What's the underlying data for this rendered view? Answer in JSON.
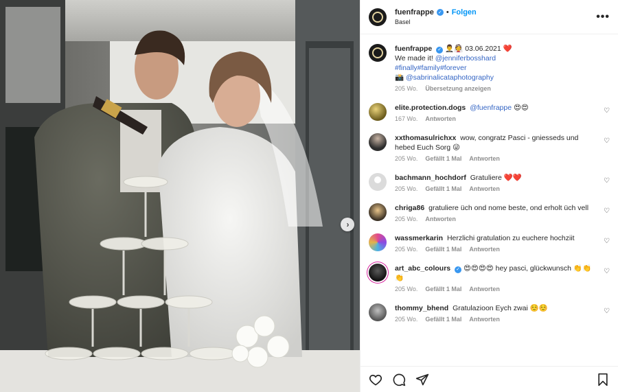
{
  "post": {
    "username": "fuenfrappe",
    "follow_label": "Folgen",
    "dot": "•",
    "location": "Basel",
    "more_label": "•••",
    "next_label": "›"
  },
  "caption": {
    "username": "fuenfrappe",
    "emoji_prefix": "🤵‍♂️👰",
    "date": "03.06.2021",
    "heart": "❤️",
    "line1_text": "We made it!",
    "line1_mention": "@jenniferbosshard",
    "line2_tags": "#finally#family#forever",
    "line3_emoji": "📸",
    "line3_mention": "@sabrinalicataphotography",
    "age": "205 Wo.",
    "translate": "Übersetzung anzeigen"
  },
  "comments": [
    {
      "username": "elite.protection.dogs",
      "text": "",
      "mention": "@fuenfrappe",
      "suffix": "😍😍",
      "age": "167 Wo.",
      "likes": "",
      "reply": "Antworten"
    },
    {
      "username": "xxthomasulrichxx",
      "text": "wow, congratz Pasci - gniesseds und hebed Euch Sorg 😜",
      "mention": "",
      "suffix": "",
      "age": "205 Wo.",
      "likes": "Gefällt 1 Mal",
      "reply": "Antworten"
    },
    {
      "username": "bachmann_hochdorf",
      "text": "Gratuliere",
      "mention": "",
      "suffix": "❤️❤️",
      "age": "205 Wo.",
      "likes": "Gefällt 1 Mal",
      "reply": "Antworten"
    },
    {
      "username": "chriga86",
      "text": "gratuliere üch ond nome beste, ond erholt üch vell",
      "mention": "",
      "suffix": "",
      "age": "205 Wo.",
      "likes": "",
      "reply": "Antworten"
    },
    {
      "username": "wassmerkarin",
      "text": "Herzlichi gratulation zu euchere hochziit",
      "mention": "",
      "suffix": "",
      "age": "205 Wo.",
      "likes": "Gefällt 1 Mal",
      "reply": "Antworten"
    },
    {
      "username": "art_abc_colours",
      "text": "😍😍😍😍 hey pasci, glückwunsch 👏👏👏",
      "mention": "",
      "suffix": "",
      "age": "205 Wo.",
      "likes": "Gefällt 1 Mal",
      "reply": "Antworten"
    },
    {
      "username": "thommy_bhend",
      "text": "Gratulazioon Eych zwai ☺️☺️",
      "mention": "",
      "suffix": "",
      "age": "205 Wo.",
      "likes": "Gefällt 1 Mal",
      "reply": "Antworten"
    }
  ],
  "icons": {
    "like": "heart-icon",
    "comment": "comment-icon",
    "share": "share-icon",
    "save": "bookmark-icon",
    "verified": "verified-badge-icon",
    "comment_like": "heart-outline-icon"
  },
  "colors": {
    "accent": "#0095f6",
    "verified": "#3897f0",
    "secondary_text": "#8e8e8e",
    "heart": "#ed4956"
  }
}
